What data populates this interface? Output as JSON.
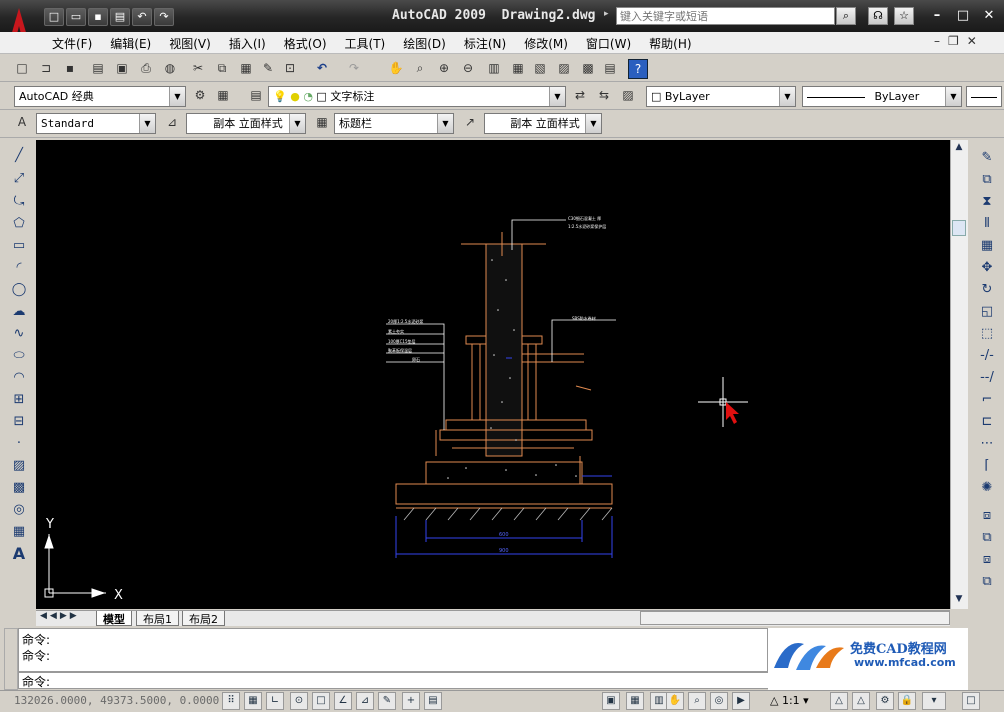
{
  "window": {
    "title": "AutoCAD 2009  Drawing2.dwg",
    "search_placeholder": "键入关键字或短语"
  },
  "menu": [
    "文件(F)",
    "编辑(E)",
    "视图(V)",
    "插入(I)",
    "格式(O)",
    "工具(T)",
    "绘图(D)",
    "标注(N)",
    "修改(M)",
    "窗口(W)",
    "帮助(H)"
  ],
  "toolbars": {
    "workspace": "AutoCAD 经典",
    "layer": "文字标注",
    "color": "ByLayer",
    "linetype": "ByLayer",
    "text_style": "Standard",
    "dim_style": "副本 立面样式",
    "table_style": "标题栏",
    "mleader_style": "副本 立面样式"
  },
  "drawing": {
    "ucs_x": "X",
    "ucs_y": "Y",
    "annotations": {
      "top_note_1": "C30细石混凝土 厚",
      "top_note_2": "1:2.5水泥砂浆保护层",
      "right_note": "SBS防水卷材",
      "left_notes": [
        "20厚1:2.5水泥砂浆",
        "素土夯实",
        "100厚C15垫层",
        "聚苯板保温层",
        "卵石"
      ],
      "dim_inner": "600",
      "dim_outer": "900"
    }
  },
  "layout_tabs": [
    "模型",
    "布局1",
    "布局2"
  ],
  "command": {
    "history": [
      "命令:",
      "命令:"
    ],
    "prompt": "命令:"
  },
  "watermark": {
    "name": "免费CAD教程网",
    "url": "www.mfcad.com"
  },
  "status": {
    "coordinates": "132026.0000, 49373.5000, 0.0000",
    "annotation_scale": "1:1"
  }
}
